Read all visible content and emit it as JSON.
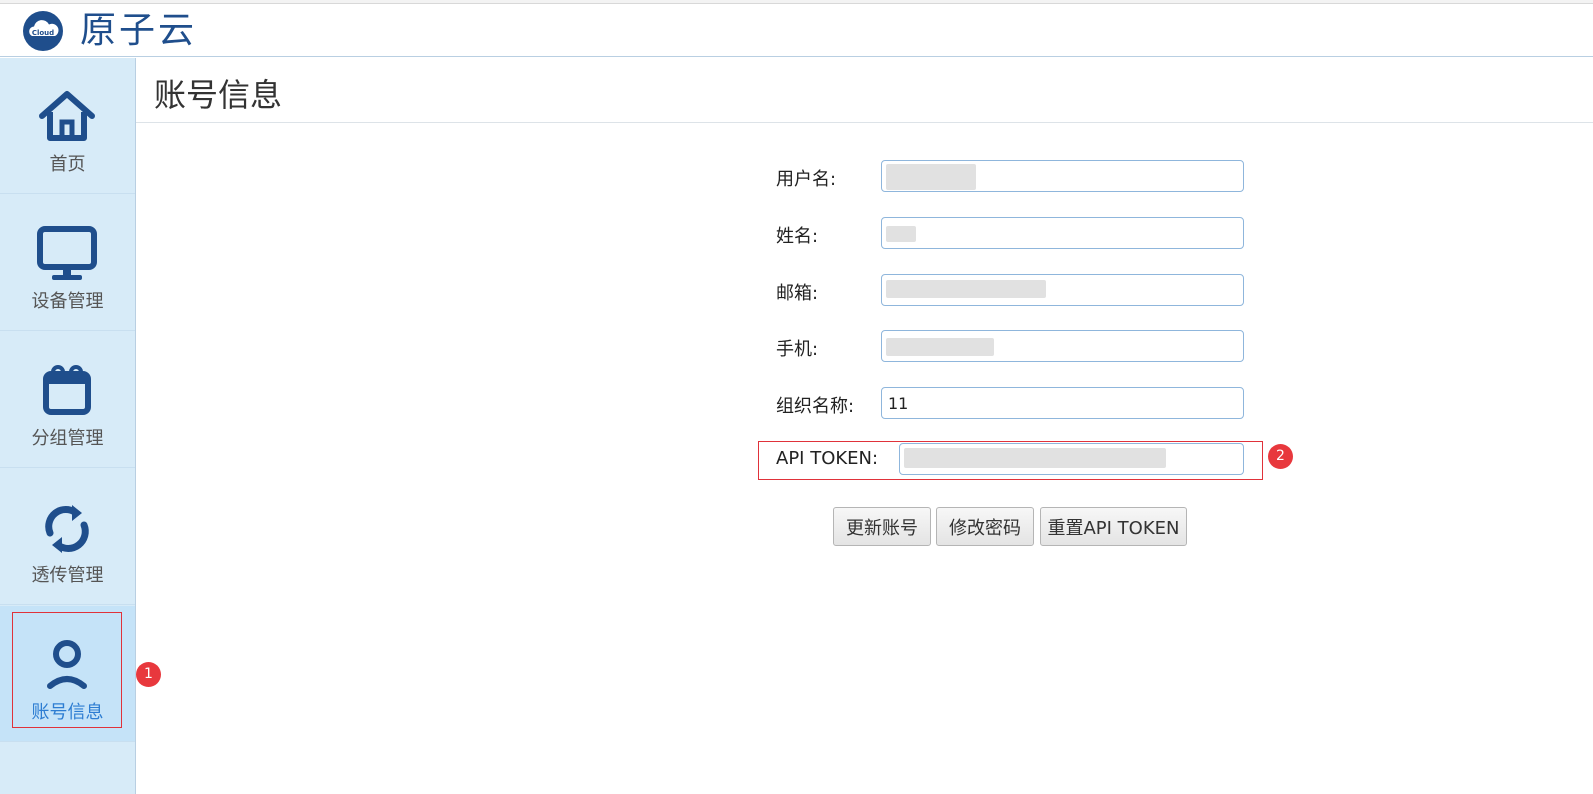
{
  "app": {
    "brand": "原子云",
    "logo_text": "Cloud"
  },
  "sidebar": {
    "items": [
      {
        "label": "首页",
        "icon": "home-icon"
      },
      {
        "label": "设备管理",
        "icon": "monitor-icon"
      },
      {
        "label": "分组管理",
        "icon": "calendar-icon"
      },
      {
        "label": "透传管理",
        "icon": "sync-icon"
      },
      {
        "label": "账号信息",
        "icon": "user-icon",
        "active": true
      }
    ]
  },
  "page": {
    "title": "账号信息"
  },
  "form": {
    "username": {
      "label": "用户名:",
      "value": ""
    },
    "name": {
      "label": "姓名:",
      "value": ""
    },
    "email": {
      "label": "邮箱:",
      "value": ""
    },
    "phone": {
      "label": "手机:",
      "value": ""
    },
    "org": {
      "label": "组织名称:",
      "value": "11"
    },
    "token": {
      "label": "API TOKEN:",
      "value": ""
    }
  },
  "buttons": {
    "update": "更新账号",
    "change_password": "修改密码",
    "reset_token": "重置API TOKEN"
  },
  "annotations": {
    "badge1": "1",
    "badge2": "2"
  },
  "colors": {
    "accent": "#1f4e8c",
    "active_text": "#2d7dd2",
    "sidebar_bg": "#d7ebf8",
    "annotation_red": "#e0323a"
  }
}
